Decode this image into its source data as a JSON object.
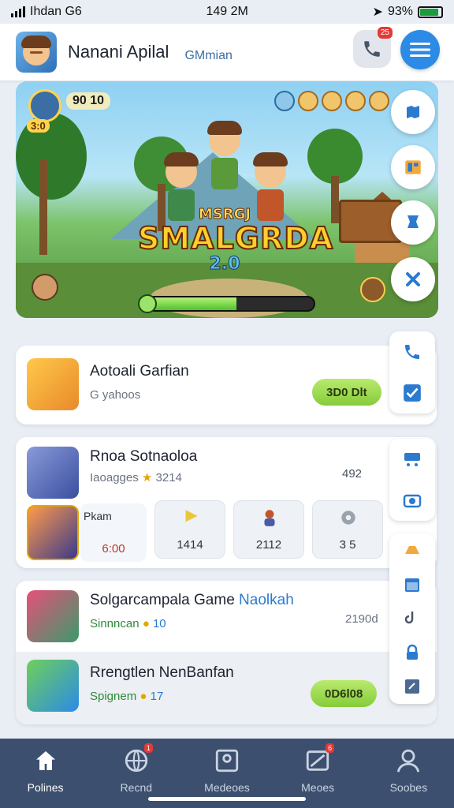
{
  "status_bar": {
    "carrier": "Ihdan G6",
    "time": "149 2M",
    "battery": "93%"
  },
  "header": {
    "title": "Nanani Apilal",
    "subtitle": "GMmian",
    "phone_badge": "25"
  },
  "hero": {
    "score": "90 10",
    "coins": "3:0",
    "logo_small": "MSRGJ",
    "logo_big": "SMALGRDA",
    "logo_third": "2.0",
    "progress": 0.55
  },
  "cards": [
    {
      "title": "Aotoali Garfian",
      "meta": "G yahoos",
      "action": "3D0 Dlt"
    },
    {
      "title": "Rnoa Sotnaoloa",
      "meta": "Iaoagges",
      "stars": "3214",
      "right": "492"
    },
    {
      "title": "Solgarcampala Game",
      "link": "Naolkah",
      "meta": "Sinnncan",
      "count": "10",
      "right": "2190d"
    },
    {
      "title": "Rrengtlen NenBanfan",
      "meta": "Spignem",
      "count": "17",
      "action": "0D6l08"
    }
  ],
  "tiles": [
    {
      "label": "6:00",
      "top": "Pkam"
    },
    {
      "label": "1414"
    },
    {
      "label": "2112"
    },
    {
      "label": "3 5"
    }
  ],
  "nav": [
    {
      "label": "Polines",
      "icon": "home-icon"
    },
    {
      "label": "Recnd",
      "icon": "globe-icon",
      "badge": "1"
    },
    {
      "label": "Medeoes",
      "icon": "frame-icon"
    },
    {
      "label": "Meoes",
      "icon": "mail-icon",
      "badge": "6"
    },
    {
      "label": "Soobes",
      "icon": "profile-icon"
    }
  ],
  "colors": {
    "accent": "#2b8be6",
    "pill_green": "#9cdb52",
    "nav_bg": "#3c4f6e"
  }
}
